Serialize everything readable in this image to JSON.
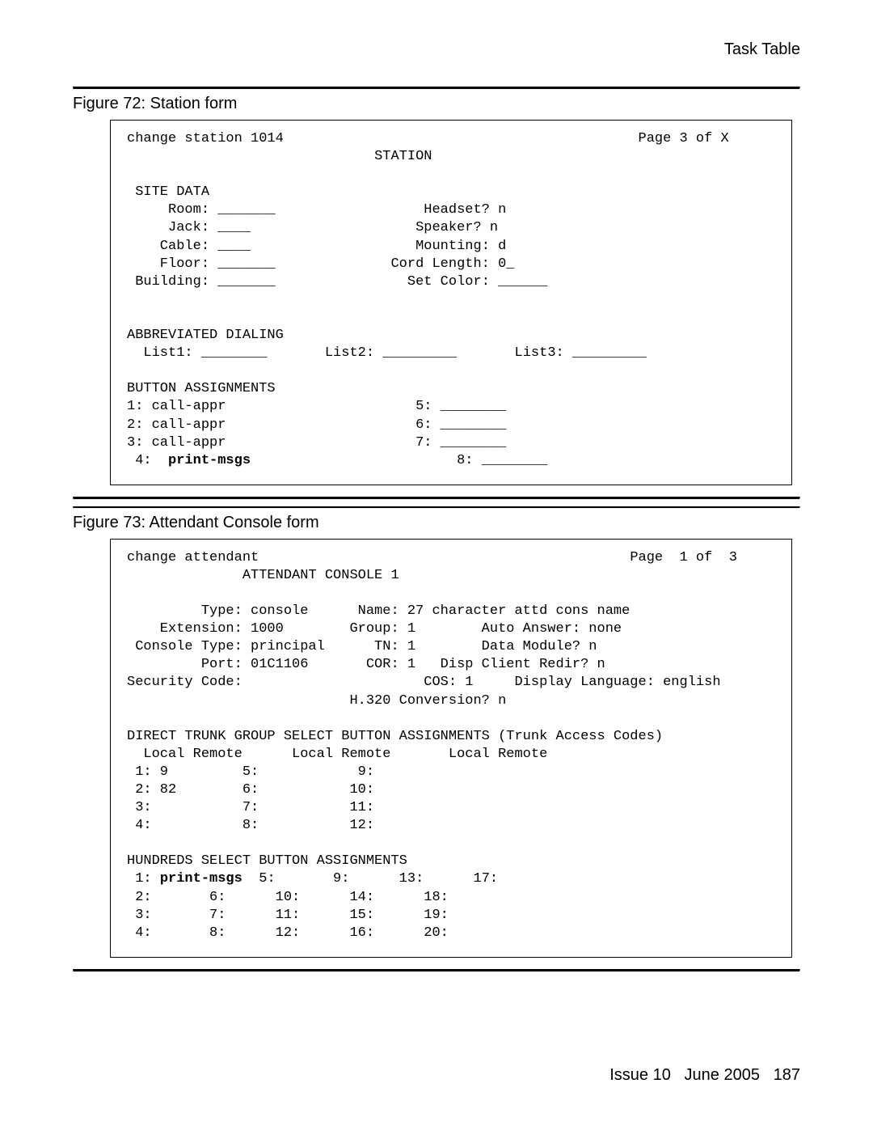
{
  "header": {
    "title": "Task Table"
  },
  "figure72": {
    "caption": "Figure 72: Station form",
    "topLeft": "change station 1014",
    "topRight": "Page 3 of X",
    "centerTitle": "STATION",
    "siteDataLabel": "SITE DATA",
    "room": "    Room: _______",
    "jack": "    Jack: ____",
    "cable": "   Cable: ____",
    "floor": "   Floor: _______",
    "building": "Building: _______",
    "headset": "   Headset? n",
    "speaker": "  Speaker? n",
    "mounting": "  Mounting: d",
    "cordlen": "Cord Length: 0_",
    "setcolor": " Set Color: ______",
    "abbrevLabel": "ABBREVIATED DIALING",
    "list1": "List1: ________",
    "list2": "List2: _________",
    "list3": "List3: _________",
    "btnLabel": "BUTTON ASSIGNMENTS",
    "b1": "1: call-appr",
    "b2": "2: call-appr",
    "b3": "3: call-appr",
    "b5": "5: ________",
    "b6": "6: ________",
    "b7": "7: ________",
    "b4a": " 4:  ",
    "b4b": "print-msgs",
    "b8": "8: ________"
  },
  "figure73": {
    "caption": "Figure 73: Attendant Console form",
    "topLeft": "change attendant",
    "topRight": "Page  1 of  3",
    "centerTitle": "ATTENDANT CONSOLE 1",
    "row1": "         Type: console      Name: 27 character attd cons name",
    "row2": "    Extension: 1000        Group: 1        Auto Answer: none",
    "row3": " Console Type: principal      TN: 1        Data Module? n",
    "row4": "         Port: 01C1106       COR: 1   Disp Client Redir? n",
    "row5": "Security Code:                      COS: 1     Display Language: english",
    "row6": "                           H.320 Conversion? n",
    "trunkHdr": "DIRECT TRUNK GROUP SELECT BUTTON ASSIGNMENTS (Trunk Access Codes)",
    "lrHdr": "  Local Remote      Local Remote       Local Remote",
    "t1": " 1: 9         5:            9:",
    "t2": " 2: 82        6:           10:",
    "t3": " 3:           7:           11:",
    "t4": " 4:           8:           12:",
    "hundHdr": "HUNDREDS SELECT BUTTON ASSIGNMENTS",
    "h1a": " 1: ",
    "h1b": "print-msgs",
    "h1c": "  5:       9:      13:      17:",
    "h2": " 2:       6:      10:      14:      18:",
    "h3": " 3:       7:      11:      15:      19:",
    "h4": " 4:       8:      12:      16:      20:"
  },
  "footer": {
    "issue": "Issue 10",
    "date": "June 2005",
    "page": "187"
  }
}
